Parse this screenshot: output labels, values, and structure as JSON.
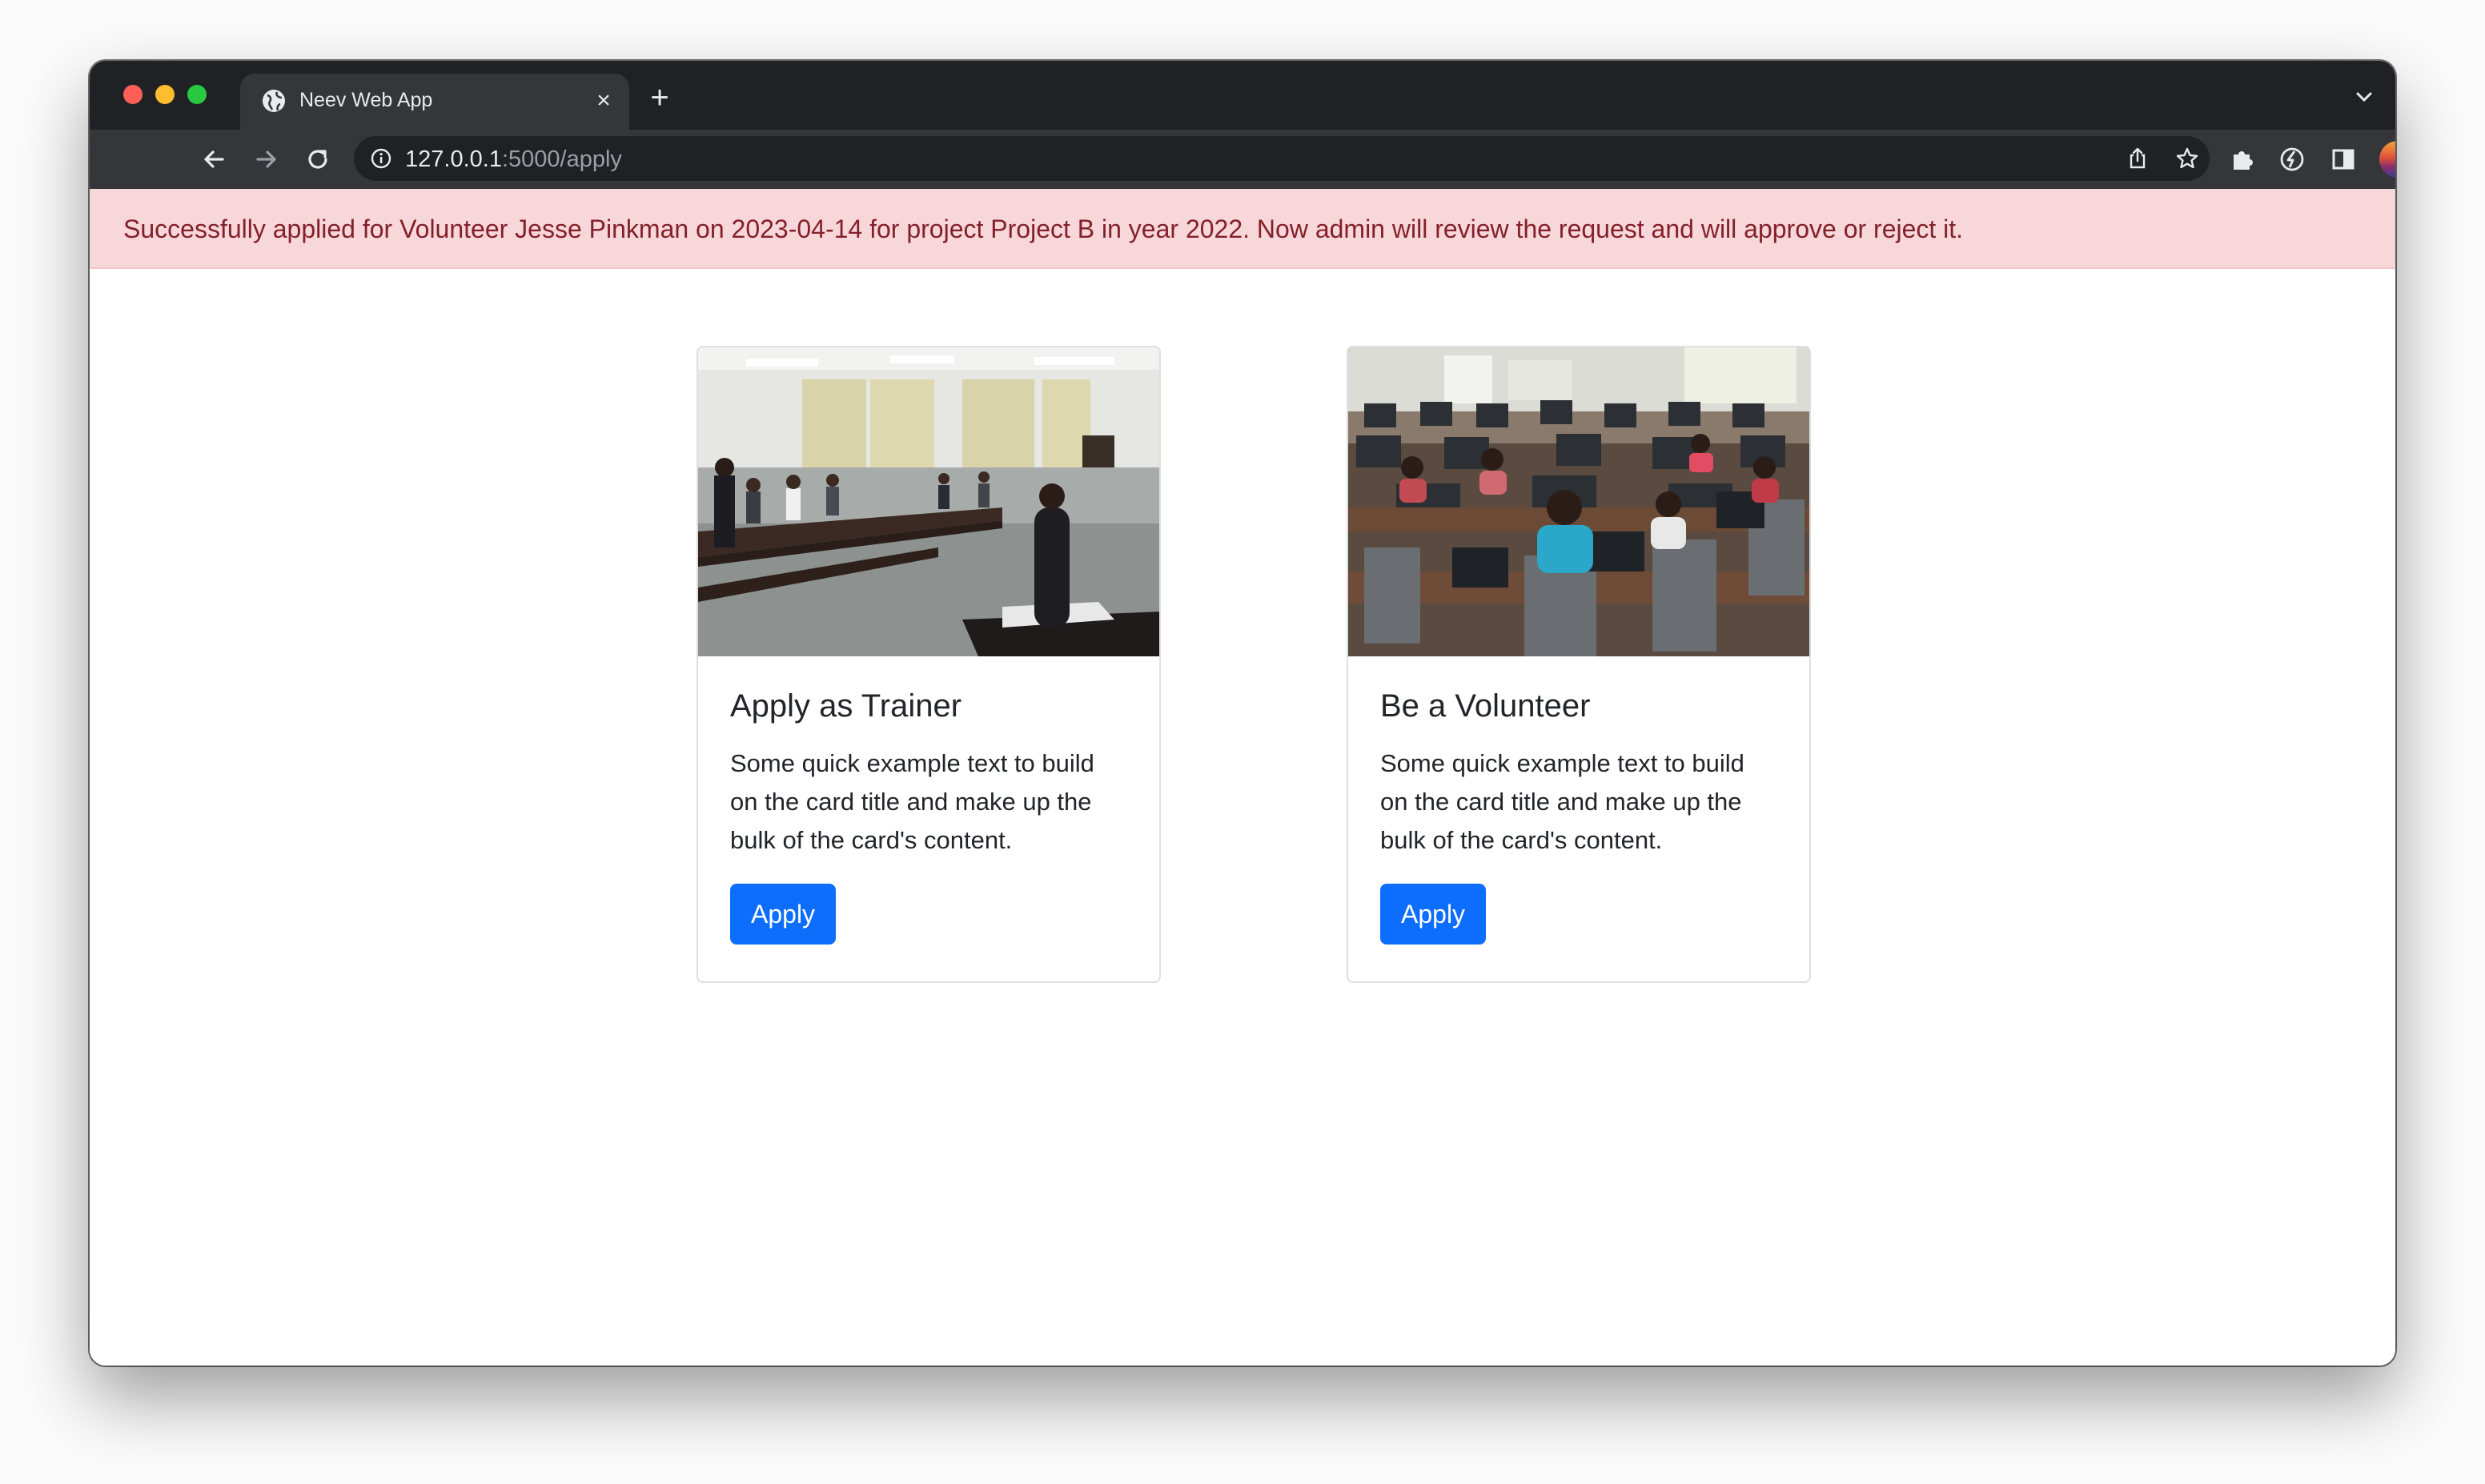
{
  "browser": {
    "tab": {
      "title": "Neev Web App",
      "close_glyph": "×"
    },
    "new_tab_glyph": "+",
    "address_bar": {
      "host": "127.0.0.1",
      "path": ":5000/apply"
    },
    "icons": {
      "back": "arrow-left-icon",
      "forward": "arrow-right-icon",
      "reload": "reload-icon",
      "site_info": "info-icon",
      "share": "share-icon",
      "bookmark": "star-icon",
      "extensions": "puzzle-icon",
      "extension_app": "extension-app-icon",
      "side_panel": "side-panel-icon",
      "menu": "kebab-menu-icon",
      "tab_search": "chevron-down-icon",
      "favicon": "globe-icon"
    },
    "colors": {
      "frame": "#202124",
      "toolbar": "#35363a",
      "text": "#e8eaed"
    }
  },
  "alert": {
    "message": "Successfully applied for Volunteer Jesse Pinkman on 2023-04-14 for project Project B in year 2022. Now admin will review the request and will approve or reject it.",
    "colors": {
      "background": "#f8d7da",
      "text": "#842029"
    }
  },
  "cards": [
    {
      "title": "Apply as Trainer",
      "text": "Some quick example text to build on the card title and make up the bulk of the card's content.",
      "button": "Apply"
    },
    {
      "title": "Be a Volunteer",
      "text": "Some quick example text to build on the card title and make up the bulk of the card's content.",
      "button": "Apply"
    }
  ],
  "colors": {
    "primary_button": "#0d6efd"
  }
}
